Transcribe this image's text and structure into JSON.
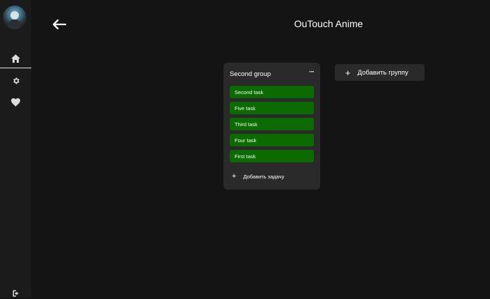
{
  "header": {
    "title": "OuTouch Anime"
  },
  "sidebar": {
    "items": [
      {
        "icon": "home-icon"
      },
      {
        "icon": "gear-icon"
      },
      {
        "icon": "heart-icon"
      }
    ],
    "footer_icon": "logout-icon"
  },
  "board": {
    "groups": [
      {
        "name": "Second group",
        "menu_label": "···",
        "tasks": [
          {
            "label": "Second task"
          },
          {
            "label": "Five task"
          },
          {
            "label": "Third task"
          },
          {
            "label": "Four task"
          },
          {
            "label": "First task"
          }
        ],
        "add_task_label": "Добавить задачу"
      }
    ],
    "add_group_label": "Добавить группу"
  },
  "colors": {
    "background": "#141414",
    "sidebar": "#1b1b1b",
    "card": "#2a2a2a",
    "task": "#0b6b00"
  }
}
